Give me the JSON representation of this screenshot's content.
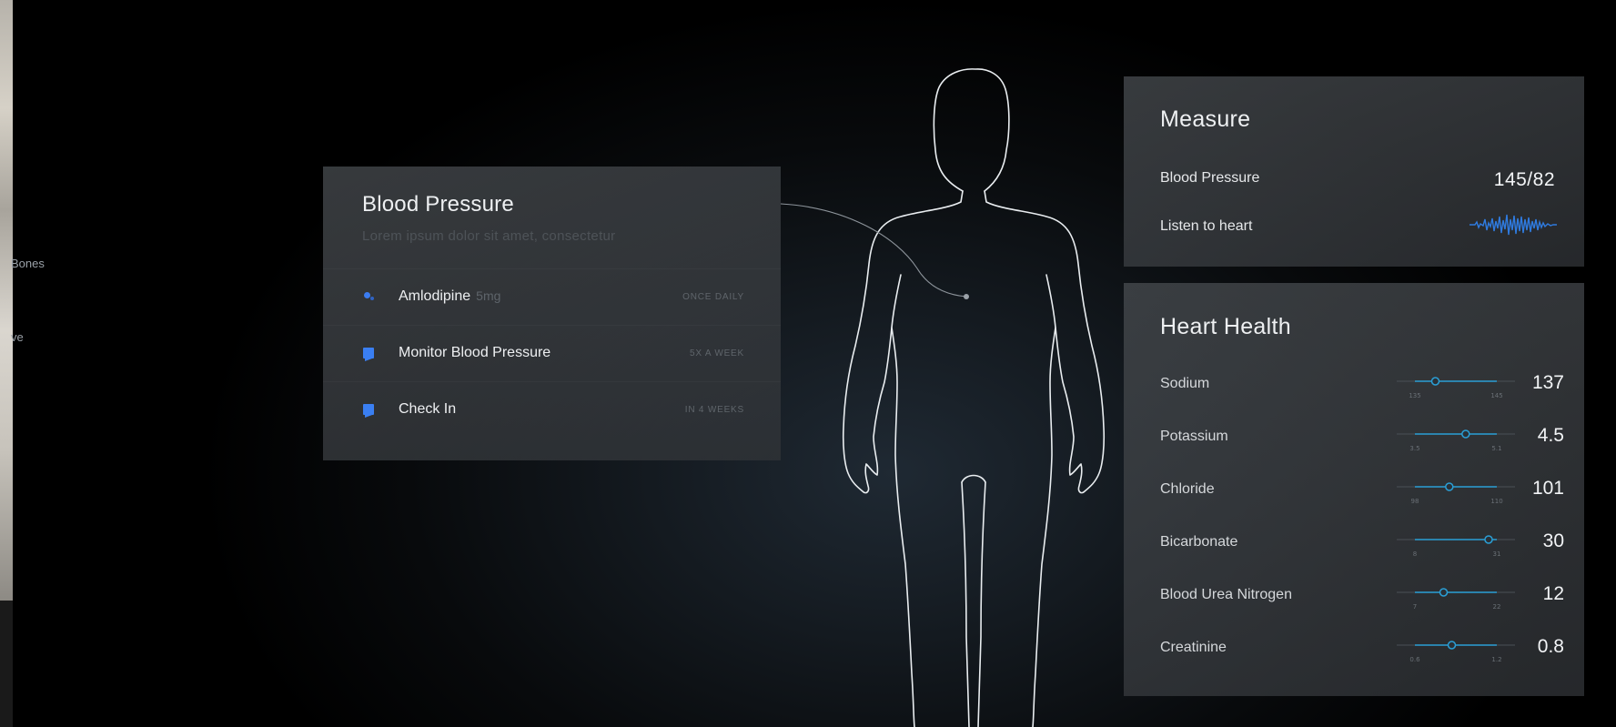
{
  "sidebar": {
    "items": [
      {
        "label": "Bones"
      },
      {
        "label": "ve"
      }
    ]
  },
  "blood_pressure_card": {
    "title": "Blood Pressure",
    "subtitle": "Lorem ipsum dolor sit amet, consectetur",
    "items": [
      {
        "icon": "pill-icon",
        "label": "Amlodipine",
        "dose": "5mg",
        "frequency": "ONCE DAILY"
      },
      {
        "icon": "clipboard-icon",
        "label": "Monitor Blood Pressure",
        "dose": "",
        "frequency": "5X A WEEK"
      },
      {
        "icon": "clipboard-icon",
        "label": "Check In",
        "dose": "",
        "frequency": "IN 4 WEEKS"
      }
    ]
  },
  "measure": {
    "title": "Measure",
    "blood_pressure_label": "Blood Pressure",
    "blood_pressure_value": "145/82",
    "listen_label": "Listen to heart",
    "waveform_icon": "heart-waveform-icon",
    "accent_color": "#2f7be0"
  },
  "heart_health": {
    "title": "Heart Health",
    "metrics": [
      {
        "name": "Sodium",
        "value": "137",
        "min": "135",
        "max": "145",
        "marker": 0.25
      },
      {
        "name": "Potassium",
        "value": "4.5",
        "min": "3.5",
        "max": "5.1",
        "marker": 0.62
      },
      {
        "name": "Chloride",
        "value": "101",
        "min": "98",
        "max": "110",
        "marker": 0.42
      },
      {
        "name": "Bicarbonate",
        "value": "30",
        "min": "8",
        "max": "31",
        "marker": 0.9
      },
      {
        "name": "Blood Urea Nitrogen",
        "value": "12",
        "min": "7",
        "max": "22",
        "marker": 0.35
      },
      {
        "name": "Creatinine",
        "value": "0.8",
        "min": "0.6",
        "max": "1.2",
        "marker": 0.45
      }
    ],
    "track_color": "#2a9fd6"
  }
}
